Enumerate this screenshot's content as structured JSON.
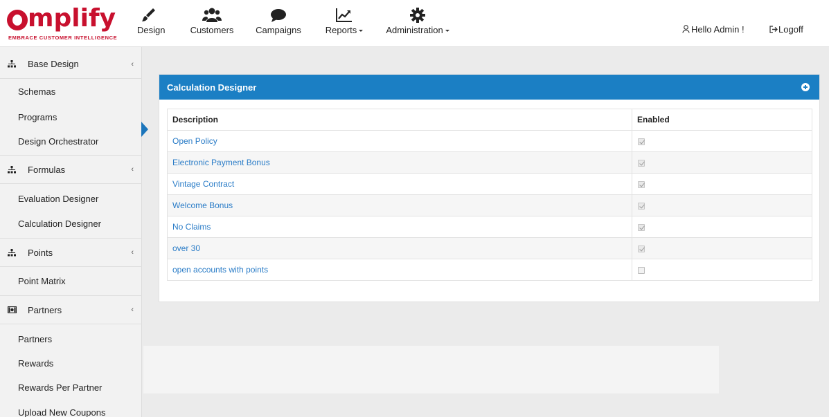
{
  "brand": {
    "name": "amplify",
    "tagline": "EMBRACE CUSTOMER INTELLIGENCE",
    "color": "#c8102e"
  },
  "nav": {
    "items": [
      {
        "label": "Design",
        "icon": "brush-icon"
      },
      {
        "label": "Customers",
        "icon": "users-icon"
      },
      {
        "label": "Campaigns",
        "icon": "speech-bubble-icon"
      },
      {
        "label": "Reports",
        "icon": "line-chart-icon",
        "dropdown": true
      },
      {
        "label": "Administration",
        "icon": "gear-icon",
        "dropdown": true
      }
    ],
    "greeting": "Hello Admin !",
    "logoff": "Logoff"
  },
  "sidebar": {
    "groups": [
      {
        "label": "Base Design",
        "icon": "sitemap-icon",
        "items": [
          "Schemas",
          "Programs",
          "Design Orchestrator"
        ]
      },
      {
        "label": "Formulas",
        "icon": "sitemap-icon",
        "items": [
          "Evaluation Designer",
          "Calculation Designer"
        ]
      },
      {
        "label": "Points",
        "icon": "sitemap-icon",
        "items": [
          "Point Matrix"
        ]
      },
      {
        "label": "Partners",
        "icon": "money-icon",
        "items": [
          "Partners",
          "Rewards",
          "Rewards Per Partner",
          "Upload New Coupons"
        ]
      }
    ]
  },
  "panel": {
    "title": "Calculation Designer",
    "accent": "#1b7fc4",
    "columns": [
      "Description",
      "Enabled"
    ],
    "rows": [
      {
        "description": "Open Policy",
        "enabled": true
      },
      {
        "description": "Electronic Payment Bonus",
        "enabled": true
      },
      {
        "description": "Vintage Contract",
        "enabled": true
      },
      {
        "description": "Welcome Bonus",
        "enabled": true
      },
      {
        "description": "No Claims",
        "enabled": true
      },
      {
        "description": "over 30",
        "enabled": true
      },
      {
        "description": "open accounts with points",
        "enabled": false
      }
    ]
  }
}
